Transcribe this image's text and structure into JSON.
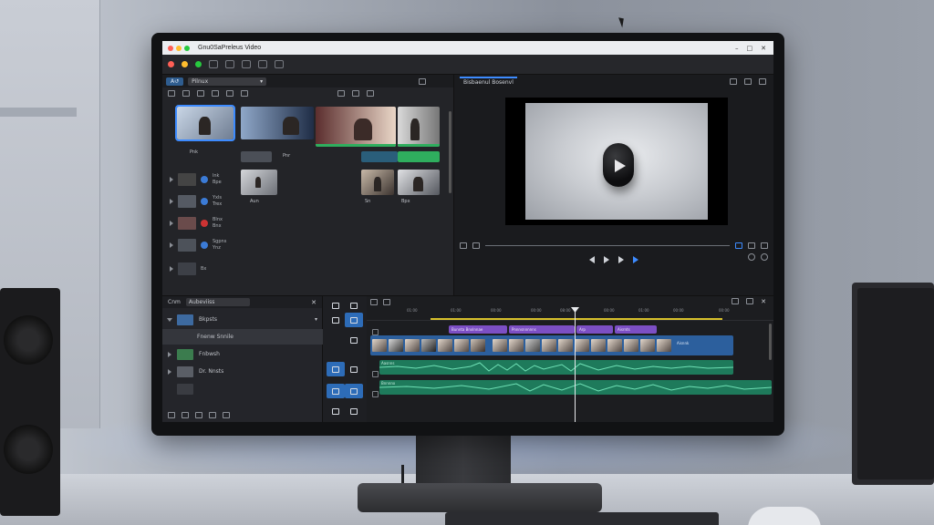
{
  "window": {
    "title": "Gnu0SaPreleus Video",
    "buttons": [
      "close-dot",
      "minimize-dot",
      "zoom-dot"
    ],
    "controls": [
      "–",
      "□",
      "✕"
    ]
  },
  "colors": {
    "accent": "#3d8bff",
    "clip_video": "#2c5f9d",
    "clip_title": "#7c4fc4",
    "clip_audio": "#1e7a5b",
    "in_out_range": "#d8c12b"
  },
  "media": {
    "tab": "Α↺",
    "dropdown": "Pilnux",
    "thumb_labels": [
      "Pnk",
      "Pnr",
      "Sn",
      "Bpx",
      "Aun"
    ],
    "list_rows": [
      {
        "line1": "lnk",
        "line2": "Bpe"
      },
      {
        "line1": "Yxls",
        "line2": "Trex"
      },
      {
        "line1": "Blnx",
        "line2": "Bnx"
      },
      {
        "line1": "Sgpns",
        "line2": "Ynz"
      },
      {
        "line1": "Bx",
        "line2": ""
      }
    ]
  },
  "viewer": {
    "tab": "Bisbaenul Bosenvl"
  },
  "project": {
    "tab": "Cnm",
    "dropdown": "Aubeviiss",
    "rows": [
      {
        "label": "Bkpsts"
      },
      {
        "label": "Fnenw Snnile",
        "selected": true
      },
      {
        "label": "Fnbwsh"
      },
      {
        "label": "Dr. Nnsts"
      },
      {
        "label": ""
      }
    ]
  },
  "timeline": {
    "ruler_labels": [
      "01:00",
      "01:00",
      "00:00",
      "00:00",
      "08:00",
      "00:00",
      "01:00",
      "00:00",
      "00:00"
    ],
    "clips": {
      "titles": [
        "Bunnta Bnxlnnae",
        "Pnnnsnnnnns",
        "Arp",
        "Aisrnts"
      ],
      "video_label": "Aisnnk",
      "audio": [
        "Aasnns",
        "Bnnnnx"
      ]
    }
  }
}
